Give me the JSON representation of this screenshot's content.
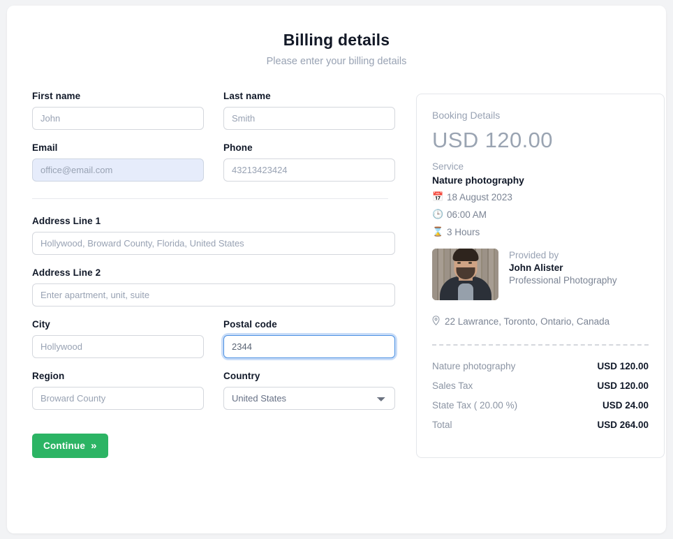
{
  "header": {
    "title": "Billing details",
    "subtitle": "Please enter your billing details"
  },
  "form": {
    "first_name": {
      "label": "First name",
      "value": "",
      "placeholder": "John"
    },
    "last_name": {
      "label": "Last name",
      "value": "",
      "placeholder": "Smith"
    },
    "email": {
      "label": "Email",
      "value": "",
      "placeholder": "office@email.com"
    },
    "phone": {
      "label": "Phone",
      "value": "",
      "placeholder": "43213423424"
    },
    "address_line_1": {
      "label": "Address Line 1",
      "value": "",
      "placeholder": "Hollywood, Broward County, Florida, United States"
    },
    "address_line_2": {
      "label": "Address Line 2",
      "value": "",
      "placeholder": "Enter apartment, unit, suite"
    },
    "city": {
      "label": "City",
      "value": "",
      "placeholder": "Hollywood"
    },
    "postal_code": {
      "label": "Postal code",
      "value": "2344",
      "placeholder": ""
    },
    "region": {
      "label": "Region",
      "value": "",
      "placeholder": "Broward County"
    },
    "country": {
      "label": "Country",
      "value": "United States",
      "options": [
        "United States"
      ]
    },
    "continue_button": {
      "label": "Continue",
      "chevron": "»"
    }
  },
  "booking": {
    "heading": "Booking Details",
    "price": "USD 120.00",
    "service_label": "Service",
    "service_name": "Nature photography",
    "date": {
      "icon": "📅",
      "text": "18 August 2023"
    },
    "time": {
      "icon": "🕒",
      "text": "06:00 AM"
    },
    "duration": {
      "icon": "⌛",
      "text": "3 Hours"
    },
    "provider": {
      "provided_by_label": "Provided by",
      "name": "John Alister",
      "business": "Professional Photography"
    },
    "location": {
      "icon": "⌕",
      "text": "22 Lawrance, Toronto, Ontario, Canada"
    },
    "price_rows": [
      {
        "label": "Nature photography",
        "value": "USD 120.00"
      },
      {
        "label": "Sales Tax",
        "value": "USD 120.00"
      },
      {
        "label": "State Tax ( 20.00 %)",
        "value": "USD 24.00"
      },
      {
        "label": "Total",
        "value": "USD 264.00"
      }
    ]
  },
  "colors": {
    "accent_green": "#2cb464",
    "focus_blue": "#4b90e2",
    "autofill_blue": "#e6ecfb",
    "text_dark": "#101828",
    "text_muted": "#98a2b3"
  }
}
